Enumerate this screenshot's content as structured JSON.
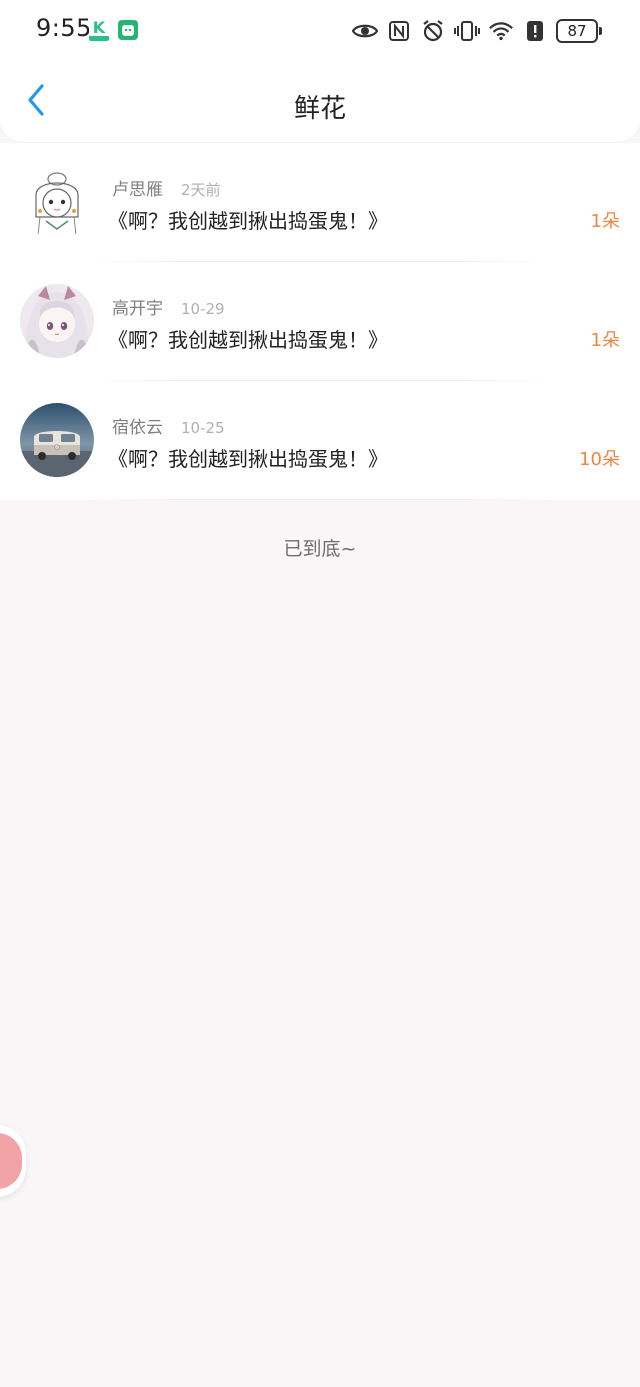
{
  "status_bar": {
    "time": "9:55",
    "app_icon_k": "K",
    "battery_level": "87",
    "icons": [
      "eye-icon",
      "nfc-icon",
      "alarm-icon",
      "vibrate-icon",
      "wifi-icon",
      "alert-icon",
      "battery-icon"
    ]
  },
  "header": {
    "title": "鲜花",
    "back_icon": "chevron-left-icon"
  },
  "colors": {
    "accent_blue": "#2196f3",
    "count_orange": "#f0863c",
    "background": "#f8f6f7"
  },
  "records": [
    {
      "name": "卢思雁",
      "time": "2天前",
      "book": "《啊？我创越到揪出捣蛋鬼！》",
      "count": "1朵"
    },
    {
      "name": "高开宇",
      "time": "10-29",
      "book": "《啊？我创越到揪出捣蛋鬼！》",
      "count": "1朵"
    },
    {
      "name": "宿依云",
      "time": "10-25",
      "book": "《啊？我创越到揪出捣蛋鬼！》",
      "count": "10朵"
    }
  ],
  "footer": {
    "end_text": "已到底~"
  }
}
